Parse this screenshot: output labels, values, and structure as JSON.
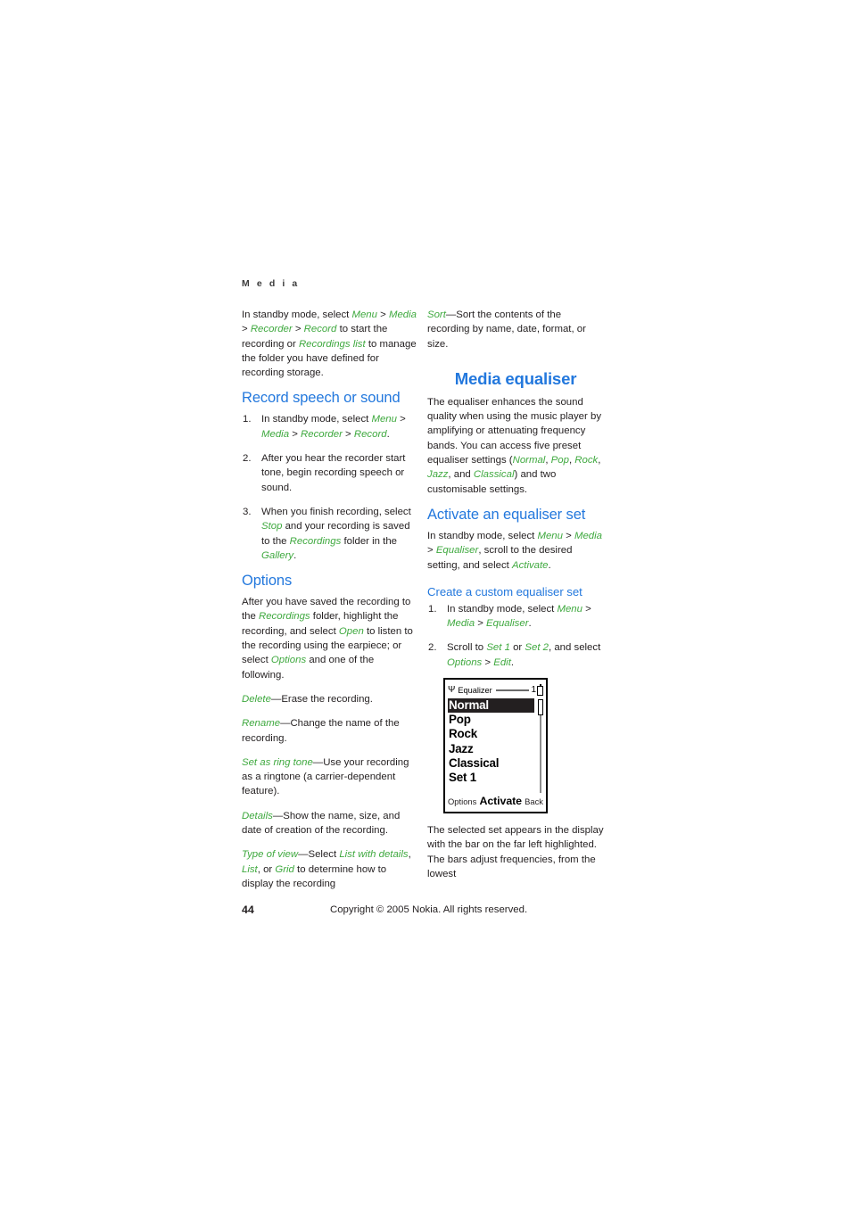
{
  "running_head": "M e d i a",
  "colors": {
    "heading_blue": "#2378dd",
    "ui_green": "#3fa93f",
    "body_black": "#231f20"
  },
  "left_column": {
    "intro": {
      "p1_a": "In standby mode, select ",
      "p1_menu": "Menu",
      "p1_b": " > ",
      "p1_media": "Media",
      "p1_c": " > ",
      "p1_recorder": "Recorder",
      "p1_d": " > ",
      "p1_record": "Record",
      "p1_e": " to start the recording or ",
      "p1_recordings_list": "Recordings list",
      "p1_f": " to manage the folder you have defined for recording storage."
    },
    "record_section": {
      "heading": "Record speech or sound",
      "step1": {
        "a": "In standby mode, select ",
        "menu": "Menu",
        "b": " > ",
        "media": "Media",
        "c": " > ",
        "recorder": "Recorder",
        "d": " > ",
        "record": "Record",
        "e": "."
      },
      "step2": "After you hear the recorder start tone, begin recording speech or sound.",
      "step3": {
        "a": "When you finish recording, select ",
        "stop": "Stop",
        "b": " and your recording is saved to the ",
        "recordings": "Recordings",
        "c": " folder in the ",
        "gallery": "Gallery",
        "d": "."
      }
    },
    "options_section": {
      "heading": "Options",
      "intro": {
        "a": "After you have saved the recording to the ",
        "recordings": "Recordings",
        "b": " folder, highlight the recording, and select ",
        "open": "Open",
        "c": " to listen to the recording using the earpiece; or select ",
        "options": "Options",
        "d": " and one of the following."
      },
      "delete": {
        "term": "Delete",
        "desc": "—Erase the recording."
      },
      "rename": {
        "term": "Rename",
        "desc": "—Change the name of the recording."
      },
      "ringtone": {
        "term": "Set as ring tone",
        "desc": "—Use your recording as a ringtone (a carrier-dependent feature)."
      },
      "details": {
        "term": "Details",
        "desc": "—Show the name, size, and date of creation of the recording."
      },
      "typeofview": {
        "term": "Type of view",
        "a": "—Select ",
        "list_with_details": "List with details",
        "b": ", ",
        "list": "List",
        "c": ", or ",
        "grid": "Grid",
        "d": " to determine how to display the recording"
      }
    }
  },
  "right_column": {
    "sort": {
      "term": "Sort",
      "desc": "—Sort the contents of the recording by name, date, format, or size."
    },
    "chapter_heading": "Media equaliser",
    "equaliser_intro": {
      "a": "The equaliser enhances the sound quality when using the music player by amplifying or attenuating frequency bands. You can access five preset equaliser settings (",
      "normal": "Normal",
      "b": ", ",
      "pop": "Pop",
      "c": ", ",
      "rock": "Rock",
      "d": ", ",
      "jazz": "Jazz",
      "e": ", and ",
      "classical": "Classical",
      "f": ") and two customisable settings."
    },
    "activate_section": {
      "heading": "Activate an equaliser set",
      "body": {
        "a": "In standby mode, select ",
        "menu": "Menu",
        "b": " > ",
        "media": "Media",
        "c": " > ",
        "equaliser": "Equaliser",
        "d": ", scroll to the desired setting, and select ",
        "activate": "Activate",
        "e": "."
      }
    },
    "create_section": {
      "heading": "Create a custom equaliser set",
      "step1": {
        "a": "In standby mode, select ",
        "menu": "Menu",
        "b": " > ",
        "media": "Media",
        "c": " > ",
        "equaliser": "Equaliser",
        "d": "."
      },
      "step2": {
        "a": "Scroll to ",
        "set1": "Set 1",
        "b": " or ",
        "set2": "Set 2",
        "c": ", and select ",
        "options": "Options",
        "d": " > ",
        "edit": "Edit",
        "e": "."
      }
    },
    "after_figure": "The selected set appears in the display with the bar on the far left highlighted. The bars adjust frequencies, from the lowest"
  },
  "phone_figure": {
    "signal_icon": "signal-antenna-icon",
    "title": "Equalizer",
    "battery_level": "1",
    "battery_icon": "battery-icon",
    "items": [
      "Normal",
      "Pop",
      "Rock",
      "Jazz",
      "Classical",
      "Set 1"
    ],
    "selected_index": 0,
    "softkeys": {
      "left": "Options",
      "center": "Activate",
      "right": "Back"
    }
  },
  "footer": {
    "page_number": "44",
    "copyright": "Copyright © 2005 Nokia. All rights reserved."
  }
}
